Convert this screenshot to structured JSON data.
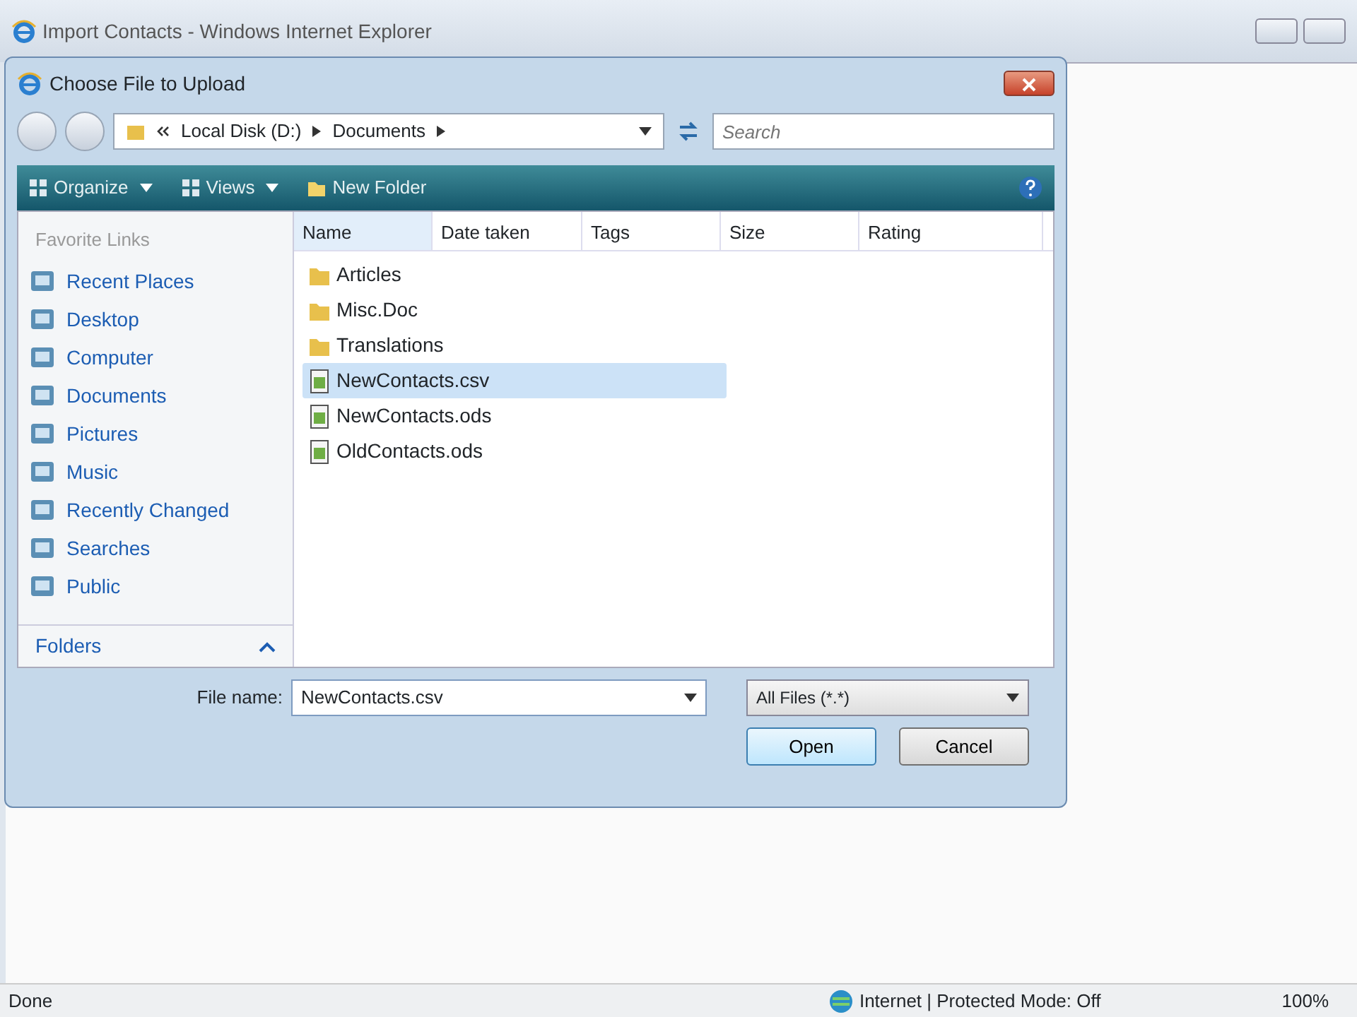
{
  "browser": {
    "title": "Import Contacts - Windows Internet Explorer",
    "status": "Done",
    "zone": "Internet | Protected Mode: Off",
    "zoom": "100%"
  },
  "dialog": {
    "title": "Choose File to Upload",
    "breadcrumb": [
      {
        "label": "Local Disk (D:)"
      },
      {
        "label": "Documents"
      }
    ],
    "search": {
      "placeholder": "Search"
    },
    "toolbar": [
      {
        "label": "Organize",
        "kind": "menu"
      },
      {
        "label": "Views",
        "kind": "menu"
      },
      {
        "label": "New Folder",
        "kind": "button"
      }
    ],
    "favorites_title": "Favorite Links",
    "favorites": [
      {
        "label": "Recent Places"
      },
      {
        "label": "Desktop"
      },
      {
        "label": "Computer"
      },
      {
        "label": "Documents"
      },
      {
        "label": "Pictures"
      },
      {
        "label": "Music"
      },
      {
        "label": "Recently Changed"
      },
      {
        "label": "Searches"
      },
      {
        "label": "Public"
      }
    ],
    "folders_label": "Folders",
    "columns": [
      {
        "label": "Name",
        "sorted": true
      },
      {
        "label": "Date taken",
        "sorted": false
      },
      {
        "label": "Tags",
        "sorted": false
      },
      {
        "label": "Size",
        "sorted": false
      },
      {
        "label": "Rating",
        "sorted": false
      }
    ],
    "files": [
      {
        "name": "Articles",
        "kind": "folder",
        "selected": false
      },
      {
        "name": "Misc.Doc",
        "kind": "folder",
        "selected": false
      },
      {
        "name": "Translations",
        "kind": "folder",
        "selected": false
      },
      {
        "name": "NewContacts.csv",
        "kind": "file",
        "selected": true
      },
      {
        "name": "NewContacts.ods",
        "kind": "file",
        "selected": false
      },
      {
        "name": "OldContacts.ods",
        "kind": "file",
        "selected": false
      }
    ],
    "file_name": {
      "label": "File name:",
      "value": "NewContacts.csv"
    },
    "file_type": "All Files (*.*)",
    "buttons": [
      {
        "label": "Open",
        "default": true
      },
      {
        "label": "Cancel",
        "default": false
      }
    ]
  }
}
